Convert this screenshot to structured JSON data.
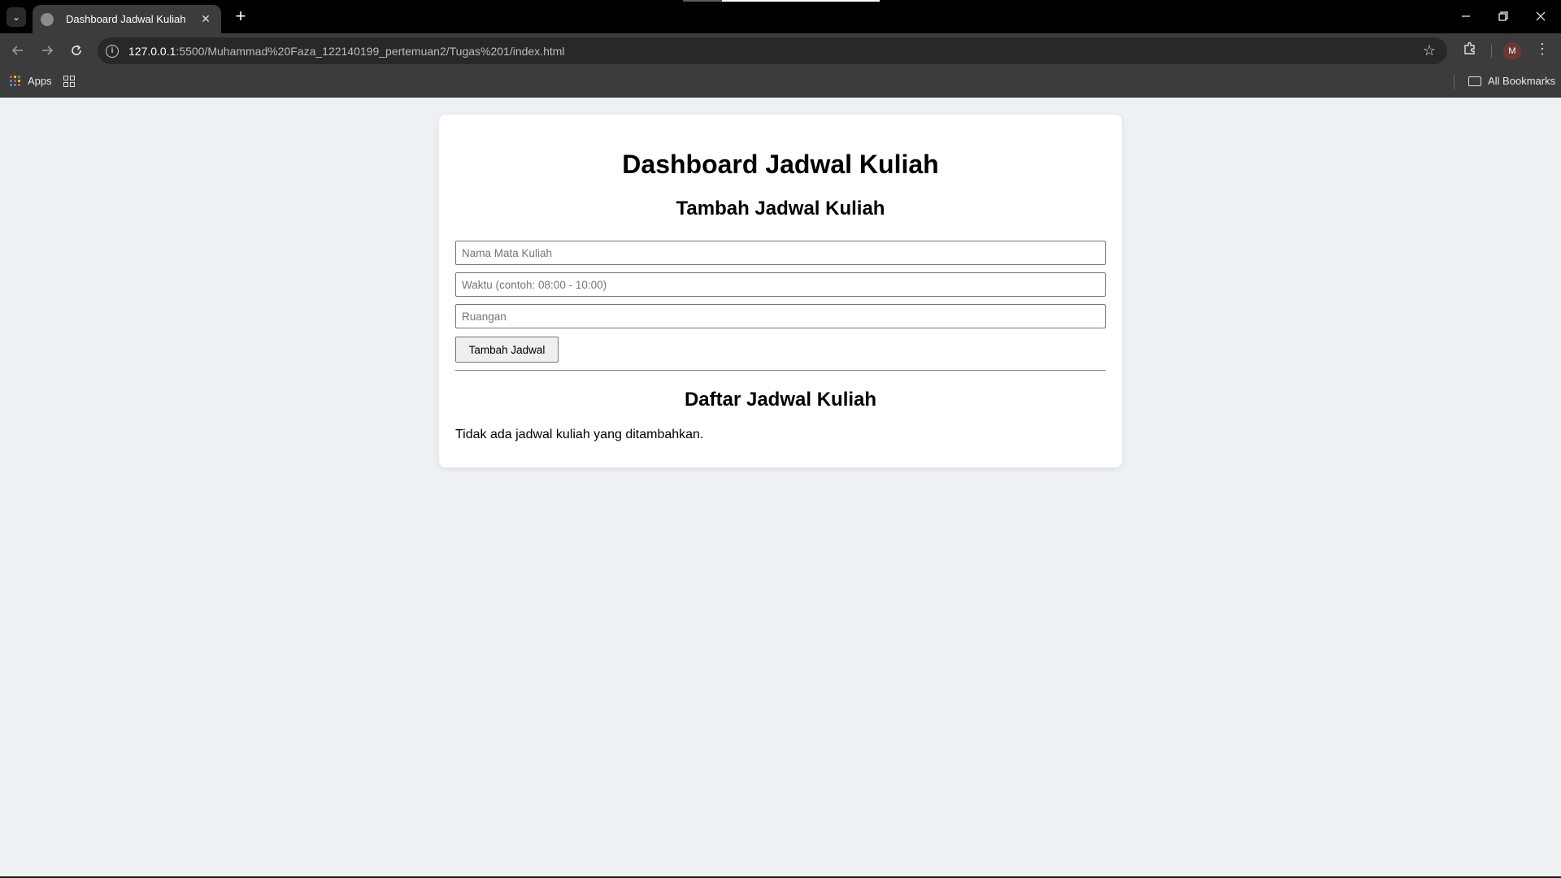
{
  "browser": {
    "tab_title": "Dashboard Jadwal Kuliah",
    "tab_close": "✕",
    "new_tab": "+",
    "url_host": "127.0.0.1",
    "url_rest": ":5500/Muhammad%20Faza_122140199_pertemuan2/Tugas%201/index.html",
    "profile_initial": "M",
    "bookmarks": {
      "apps_label": "Apps",
      "all_bookmarks_label": "All Bookmarks"
    },
    "icons": {
      "tab_search": "chevron-down-icon",
      "back": "arrow-left-icon",
      "forward": "arrow-right-icon",
      "reload": "reload-icon",
      "site_info": "info-icon",
      "bookmark_star": "star-icon",
      "extensions": "puzzle-icon",
      "menu": "kebab-menu-icon",
      "minimize": "minimize-icon",
      "restore": "restore-icon",
      "close": "close-icon"
    }
  },
  "page": {
    "title": "Dashboard Jadwal Kuliah",
    "form": {
      "heading": "Tambah Jadwal Kuliah",
      "course_placeholder": "Nama Mata Kuliah",
      "time_placeholder": "Waktu (contoh: 08:00 - 10:00)",
      "room_placeholder": "Ruangan",
      "submit_label": "Tambah Jadwal"
    },
    "list": {
      "heading": "Daftar Jadwal Kuliah",
      "empty_message": "Tidak ada jadwal kuliah yang ditambahkan."
    }
  }
}
